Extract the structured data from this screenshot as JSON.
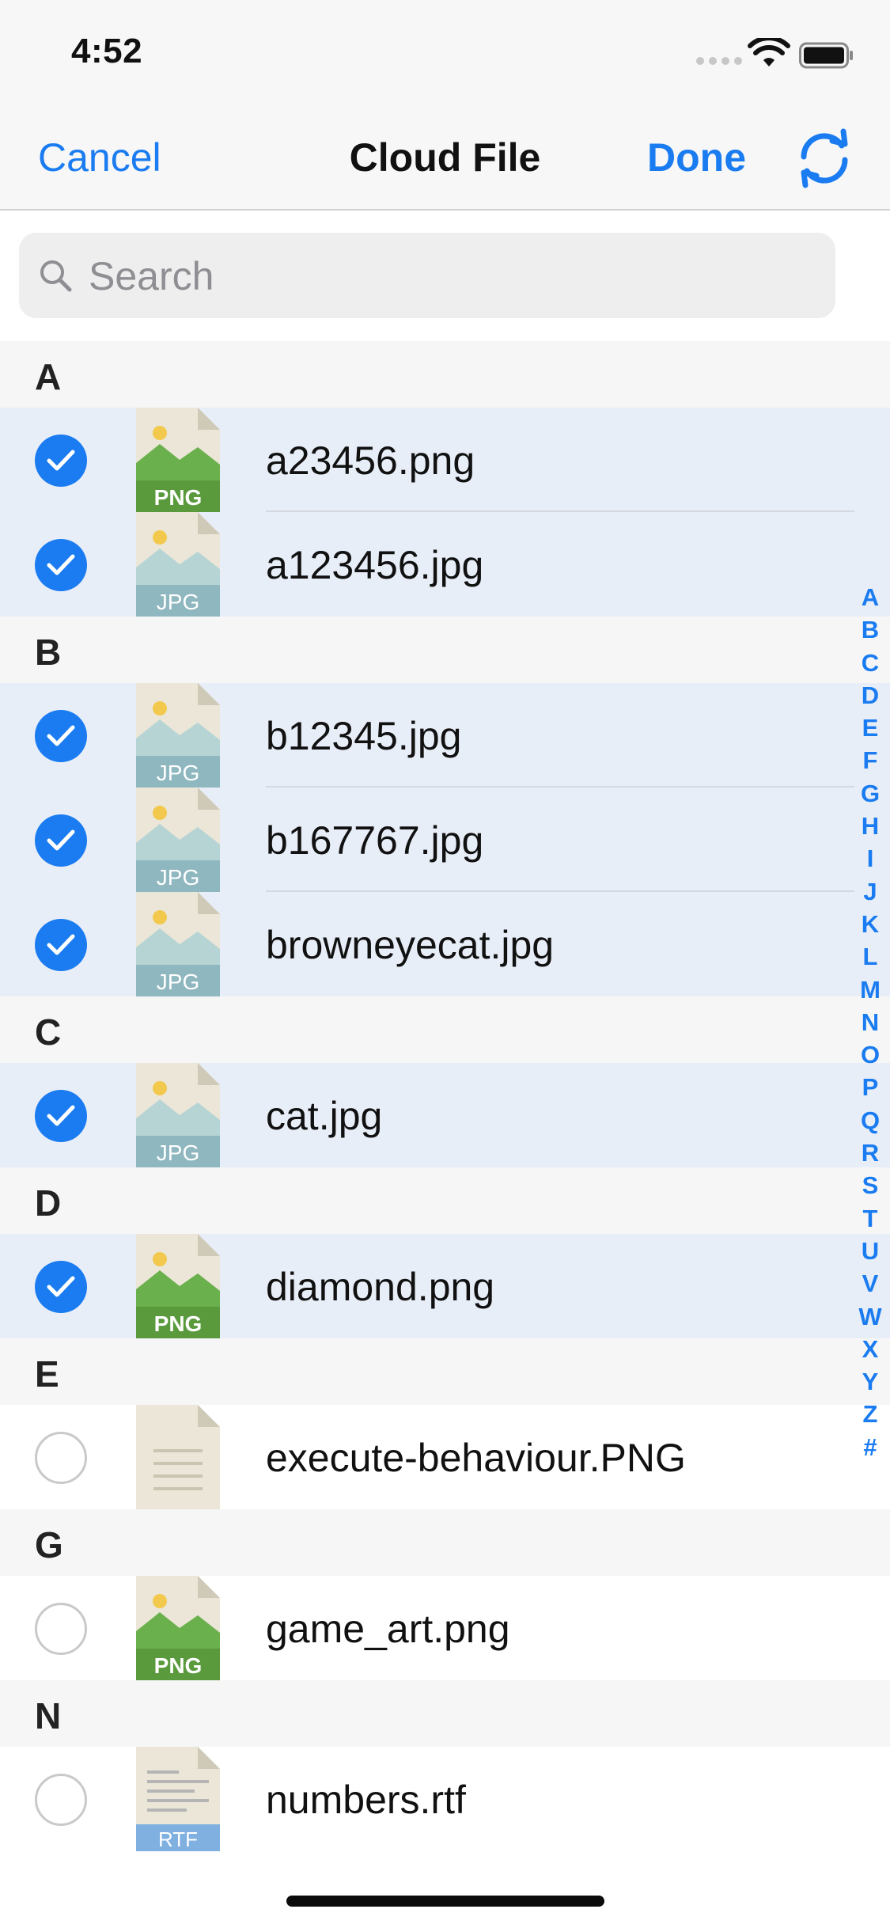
{
  "status_bar": {
    "time": "4:52"
  },
  "nav": {
    "cancel_label": "Cancel",
    "title": "Cloud File",
    "done_label": "Done",
    "sync_icon": "sync-icon"
  },
  "search": {
    "placeholder": "Search"
  },
  "sections": [
    {
      "letter": "A",
      "files": [
        {
          "name": "a23456.png",
          "type": "PNG",
          "selected": true
        },
        {
          "name": "a123456.jpg",
          "type": "JPG",
          "selected": true
        }
      ]
    },
    {
      "letter": "B",
      "files": [
        {
          "name": "b12345.jpg",
          "type": "JPG",
          "selected": true
        },
        {
          "name": "b167767.jpg",
          "type": "JPG",
          "selected": true
        },
        {
          "name": "browneyecat.jpg",
          "type": "JPG",
          "selected": true
        }
      ]
    },
    {
      "letter": "C",
      "files": [
        {
          "name": "cat.jpg",
          "type": "JPG",
          "selected": true
        }
      ]
    },
    {
      "letter": "D",
      "files": [
        {
          "name": "diamond.png",
          "type": "PNG",
          "selected": true
        }
      ]
    },
    {
      "letter": "E",
      "files": [
        {
          "name": "execute-behaviour.PNG",
          "type": "DOC",
          "selected": false
        }
      ]
    },
    {
      "letter": "G",
      "files": [
        {
          "name": "game_art.png",
          "type": "PNG",
          "selected": false
        }
      ]
    },
    {
      "letter": "N",
      "files": [
        {
          "name": "numbers.rtf",
          "type": "RTF",
          "selected": false
        }
      ]
    }
  ],
  "index_letters": [
    "A",
    "B",
    "C",
    "D",
    "E",
    "F",
    "G",
    "H",
    "I",
    "J",
    "K",
    "L",
    "M",
    "N",
    "O",
    "P",
    "Q",
    "R",
    "S",
    "T",
    "U",
    "V",
    "W",
    "X",
    "Y",
    "Z",
    "#"
  ],
  "colors": {
    "accent": "#1a7cf0",
    "selected_row": "#e8eef8",
    "section_bg": "#f6f6f6",
    "png_green": "#6ab04c",
    "jpg_teal": "#8fb7bf"
  }
}
